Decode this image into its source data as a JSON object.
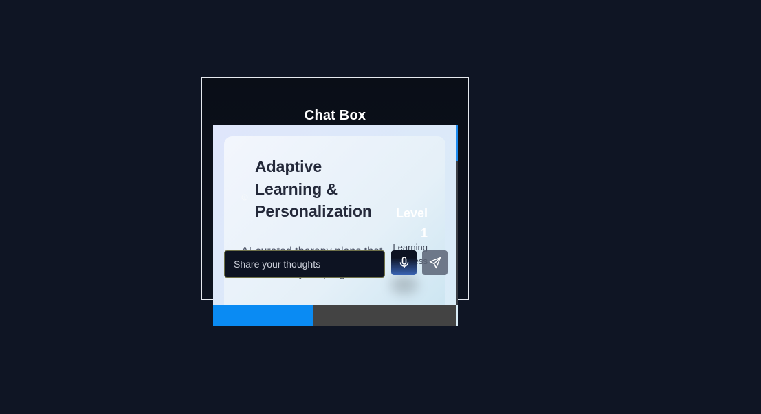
{
  "chat": {
    "title": "Chat Box"
  },
  "card": {
    "icon": "info-icon",
    "title": "Adaptive Learning & Personalization",
    "description": "AI-curated therapy plans that evolve with your progress",
    "level_label": "Level 1",
    "progress_label": "Learning Progress"
  },
  "progress": {
    "value_percent": 41,
    "fill_color": "#0a8bf3",
    "track_color": "#434343"
  },
  "composer": {
    "placeholder": "Share your thoughts",
    "mic_icon": "microphone-icon",
    "send_icon": "send-icon"
  },
  "colors": {
    "page_background": "#0f1524",
    "accent": "#1e8cf0"
  }
}
